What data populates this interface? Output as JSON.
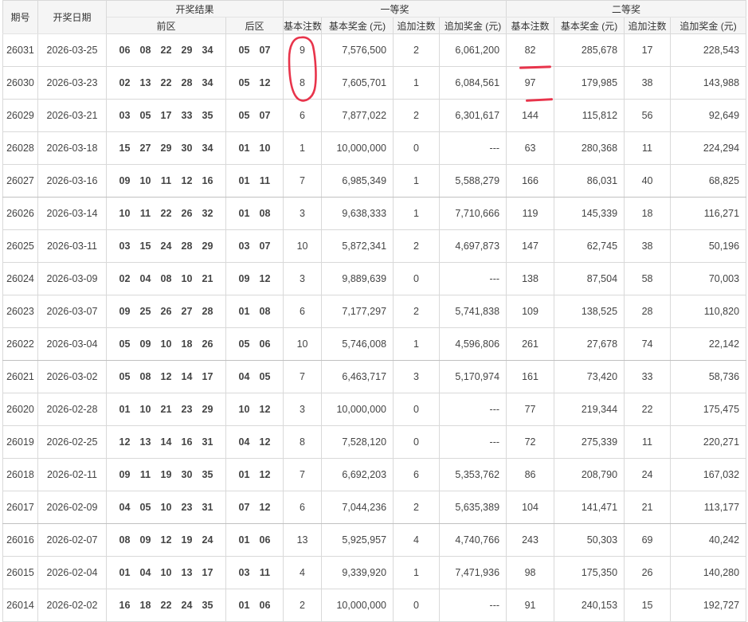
{
  "header": {
    "issue": "期号",
    "date": "开奖日期",
    "result": "开奖结果",
    "front": "前区",
    "back": "后区",
    "first_prize": "一等奖",
    "second_prize": "二等奖",
    "sub": [
      "基本注数",
      "基本奖金 (元)",
      "追加注数",
      "追加奖金 (元)",
      "基本注数",
      "基本奖金 (元)",
      "追加注数",
      "追加奖金 (元)"
    ]
  },
  "rows": [
    {
      "issue": "26031",
      "date": "2026-03-25",
      "front": [
        "06",
        "08",
        "22",
        "29",
        "34"
      ],
      "back": [
        "05",
        "07"
      ],
      "p1_count": "9",
      "p1_prize": "7,576,500",
      "p1_add_count": "2",
      "p1_add_prize": "6,061,200",
      "p2_count": "82",
      "p2_prize": "285,678",
      "p2_add_count": "17",
      "p2_add_prize": "228,543"
    },
    {
      "issue": "26030",
      "date": "2026-03-23",
      "front": [
        "02",
        "13",
        "22",
        "28",
        "34"
      ],
      "back": [
        "05",
        "12"
      ],
      "p1_count": "8",
      "p1_prize": "7,605,701",
      "p1_add_count": "1",
      "p1_add_prize": "6,084,561",
      "p2_count": "97",
      "p2_prize": "179,985",
      "p2_add_count": "38",
      "p2_add_prize": "143,988"
    },
    {
      "issue": "26029",
      "date": "2026-03-21",
      "front": [
        "03",
        "05",
        "17",
        "33",
        "35"
      ],
      "back": [
        "05",
        "07"
      ],
      "p1_count": "6",
      "p1_prize": "7,877,022",
      "p1_add_count": "2",
      "p1_add_prize": "6,301,617",
      "p2_count": "144",
      "p2_prize": "115,812",
      "p2_add_count": "56",
      "p2_add_prize": "92,649"
    },
    {
      "issue": "26028",
      "date": "2026-03-18",
      "front": [
        "15",
        "27",
        "29",
        "30",
        "34"
      ],
      "back": [
        "01",
        "10"
      ],
      "p1_count": "1",
      "p1_prize": "10,000,000",
      "p1_add_count": "0",
      "p1_add_prize": "---",
      "p2_count": "63",
      "p2_prize": "280,368",
      "p2_add_count": "11",
      "p2_add_prize": "224,294"
    },
    {
      "issue": "26027",
      "date": "2026-03-16",
      "front": [
        "09",
        "10",
        "11",
        "12",
        "16"
      ],
      "back": [
        "01",
        "11"
      ],
      "p1_count": "7",
      "p1_prize": "6,985,349",
      "p1_add_count": "1",
      "p1_add_prize": "5,588,279",
      "p2_count": "166",
      "p2_prize": "86,031",
      "p2_add_count": "40",
      "p2_add_prize": "68,825"
    },
    {
      "issue": "26026",
      "date": "2026-03-14",
      "front": [
        "10",
        "11",
        "22",
        "26",
        "32"
      ],
      "back": [
        "01",
        "08"
      ],
      "p1_count": "3",
      "p1_prize": "9,638,333",
      "p1_add_count": "1",
      "p1_add_prize": "7,710,666",
      "p2_count": "119",
      "p2_prize": "145,339",
      "p2_add_count": "18",
      "p2_add_prize": "116,271"
    },
    {
      "issue": "26025",
      "date": "2026-03-11",
      "front": [
        "03",
        "15",
        "24",
        "28",
        "29"
      ],
      "back": [
        "03",
        "07"
      ],
      "p1_count": "10",
      "p1_prize": "5,872,341",
      "p1_add_count": "2",
      "p1_add_prize": "4,697,873",
      "p2_count": "147",
      "p2_prize": "62,745",
      "p2_add_count": "38",
      "p2_add_prize": "50,196"
    },
    {
      "issue": "26024",
      "date": "2026-03-09",
      "front": [
        "02",
        "04",
        "08",
        "10",
        "21"
      ],
      "back": [
        "09",
        "12"
      ],
      "p1_count": "3",
      "p1_prize": "9,889,639",
      "p1_add_count": "0",
      "p1_add_prize": "---",
      "p2_count": "138",
      "p2_prize": "87,504",
      "p2_add_count": "58",
      "p2_add_prize": "70,003"
    },
    {
      "issue": "26023",
      "date": "2026-03-07",
      "front": [
        "09",
        "25",
        "26",
        "27",
        "28"
      ],
      "back": [
        "01",
        "08"
      ],
      "p1_count": "6",
      "p1_prize": "7,177,297",
      "p1_add_count": "2",
      "p1_add_prize": "5,741,838",
      "p2_count": "109",
      "p2_prize": "138,525",
      "p2_add_count": "28",
      "p2_add_prize": "110,820"
    },
    {
      "issue": "26022",
      "date": "2026-03-04",
      "front": [
        "05",
        "09",
        "10",
        "18",
        "26"
      ],
      "back": [
        "05",
        "06"
      ],
      "p1_count": "10",
      "p1_prize": "5,746,008",
      "p1_add_count": "1",
      "p1_add_prize": "4,596,806",
      "p2_count": "261",
      "p2_prize": "27,678",
      "p2_add_count": "74",
      "p2_add_prize": "22,142"
    },
    {
      "issue": "26021",
      "date": "2026-03-02",
      "front": [
        "05",
        "08",
        "12",
        "14",
        "17"
      ],
      "back": [
        "04",
        "05"
      ],
      "p1_count": "7",
      "p1_prize": "6,463,717",
      "p1_add_count": "3",
      "p1_add_prize": "5,170,974",
      "p2_count": "161",
      "p2_prize": "73,420",
      "p2_add_count": "33",
      "p2_add_prize": "58,736"
    },
    {
      "issue": "26020",
      "date": "2026-02-28",
      "front": [
        "01",
        "10",
        "21",
        "23",
        "29"
      ],
      "back": [
        "10",
        "12"
      ],
      "p1_count": "3",
      "p1_prize": "10,000,000",
      "p1_add_count": "0",
      "p1_add_prize": "---",
      "p2_count": "77",
      "p2_prize": "219,344",
      "p2_add_count": "22",
      "p2_add_prize": "175,475"
    },
    {
      "issue": "26019",
      "date": "2026-02-25",
      "front": [
        "12",
        "13",
        "14",
        "16",
        "31"
      ],
      "back": [
        "04",
        "12"
      ],
      "p1_count": "8",
      "p1_prize": "7,528,120",
      "p1_add_count": "0",
      "p1_add_prize": "---",
      "p2_count": "72",
      "p2_prize": "275,339",
      "p2_add_count": "11",
      "p2_add_prize": "220,271"
    },
    {
      "issue": "26018",
      "date": "2026-02-11",
      "front": [
        "09",
        "11",
        "19",
        "30",
        "35"
      ],
      "back": [
        "01",
        "12"
      ],
      "p1_count": "7",
      "p1_prize": "6,692,203",
      "p1_add_count": "6",
      "p1_add_prize": "5,353,762",
      "p2_count": "86",
      "p2_prize": "208,790",
      "p2_add_count": "24",
      "p2_add_prize": "167,032"
    },
    {
      "issue": "26017",
      "date": "2026-02-09",
      "front": [
        "04",
        "05",
        "10",
        "23",
        "31"
      ],
      "back": [
        "07",
        "12"
      ],
      "p1_count": "6",
      "p1_prize": "7,044,236",
      "p1_add_count": "2",
      "p1_add_prize": "5,635,389",
      "p2_count": "104",
      "p2_prize": "141,471",
      "p2_add_count": "21",
      "p2_add_prize": "113,177"
    },
    {
      "issue": "26016",
      "date": "2026-02-07",
      "front": [
        "08",
        "09",
        "12",
        "19",
        "24"
      ],
      "back": [
        "01",
        "06"
      ],
      "p1_count": "13",
      "p1_prize": "5,925,957",
      "p1_add_count": "4",
      "p1_add_prize": "4,740,766",
      "p2_count": "243",
      "p2_prize": "50,303",
      "p2_add_count": "69",
      "p2_add_prize": "40,242"
    },
    {
      "issue": "26015",
      "date": "2026-02-04",
      "front": [
        "01",
        "04",
        "10",
        "13",
        "17"
      ],
      "back": [
        "03",
        "11"
      ],
      "p1_count": "4",
      "p1_prize": "9,339,920",
      "p1_add_count": "1",
      "p1_add_prize": "7,471,936",
      "p2_count": "98",
      "p2_prize": "175,350",
      "p2_add_count": "26",
      "p2_add_prize": "140,280"
    },
    {
      "issue": "26014",
      "date": "2026-02-02",
      "front": [
        "16",
        "18",
        "22",
        "24",
        "35"
      ],
      "back": [
        "01",
        "06"
      ],
      "p1_count": "2",
      "p1_prize": "10,000,000",
      "p1_add_count": "0",
      "p1_add_prize": "---",
      "p2_count": "91",
      "p2_prize": "240,153",
      "p2_add_count": "15",
      "p2_add_prize": "192,727"
    }
  ],
  "annotations": {
    "color": "#e8344b",
    "circle_rows": [
      "26031",
      "26030"
    ],
    "underline_rows": [
      "26031",
      "26030"
    ]
  }
}
